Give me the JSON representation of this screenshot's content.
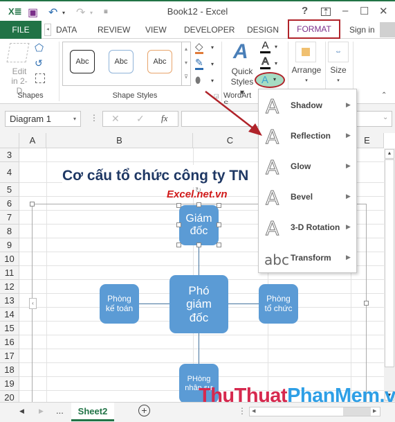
{
  "window": {
    "title": "Book12 - Excel",
    "help": "?",
    "minimize": "–",
    "maximize": "☐",
    "close": "✕"
  },
  "tabs": {
    "file": "FILE",
    "items": [
      "DATA",
      "REVIEW",
      "VIEW",
      "DEVELOPER",
      "DESIGN",
      "FORMAT"
    ],
    "active": "FORMAT",
    "sign_in": "Sign in"
  },
  "ribbon": {
    "shapes_group": {
      "label": "Shapes",
      "edit_label_1": "Edit",
      "edit_label_2": "in 2-D"
    },
    "shape_styles_group": {
      "label": "Shape Styles",
      "styles": [
        "Abc",
        "Abc",
        "Abc"
      ]
    },
    "wordart_group": {
      "label": "WordArt S",
      "quick_styles_1": "Quick",
      "quick_styles_2": "Styles"
    },
    "arrange": {
      "label": "Arrange"
    },
    "size": {
      "label": "Size"
    }
  },
  "formula_bar": {
    "name_box": "Diagram 1",
    "cancel": "✕",
    "enter": "✓",
    "fx": "fx",
    "value": ""
  },
  "grid": {
    "columns": [
      "A",
      "B",
      "C",
      "D",
      "E"
    ],
    "rows": [
      "3",
      "4",
      "5",
      "6",
      "7",
      "8",
      "9",
      "10",
      "11",
      "12",
      "13",
      "14",
      "15",
      "16",
      "17",
      "18",
      "19",
      "20"
    ],
    "title": "Cơ cấu tổ chức công ty TN",
    "subtitle": "Excel.net.vn"
  },
  "smartart": {
    "top": [
      "Giám",
      "đốc"
    ],
    "center": [
      "Phó",
      "giám",
      "đốc"
    ],
    "left": [
      "Phòng",
      "kế toán"
    ],
    "right": [
      "Phòng",
      "tổ chức"
    ],
    "bottom": [
      "PHòng",
      "nhân sự"
    ],
    "color": "#5b9bd5"
  },
  "text_effects_menu": {
    "items": [
      {
        "label": "Shadow",
        "icon": "A"
      },
      {
        "label": "Reflection",
        "icon": "A"
      },
      {
        "label": "Glow",
        "icon": "A"
      },
      {
        "label": "Bevel",
        "icon": "A"
      },
      {
        "label": "3-D Rotation",
        "icon": "A"
      },
      {
        "label": "Transform",
        "icon": "abc"
      }
    ]
  },
  "sheets": {
    "ellipsis": "...",
    "active": "Sheet2",
    "add": "+"
  },
  "watermark": {
    "part1": "ThuThuat",
    "part2": "PhanMem.vn",
    "color1": "#d6294e",
    "color2": "#2e9fe6"
  },
  "accent_color": "#217346",
  "highlight_color": "#b0232a"
}
